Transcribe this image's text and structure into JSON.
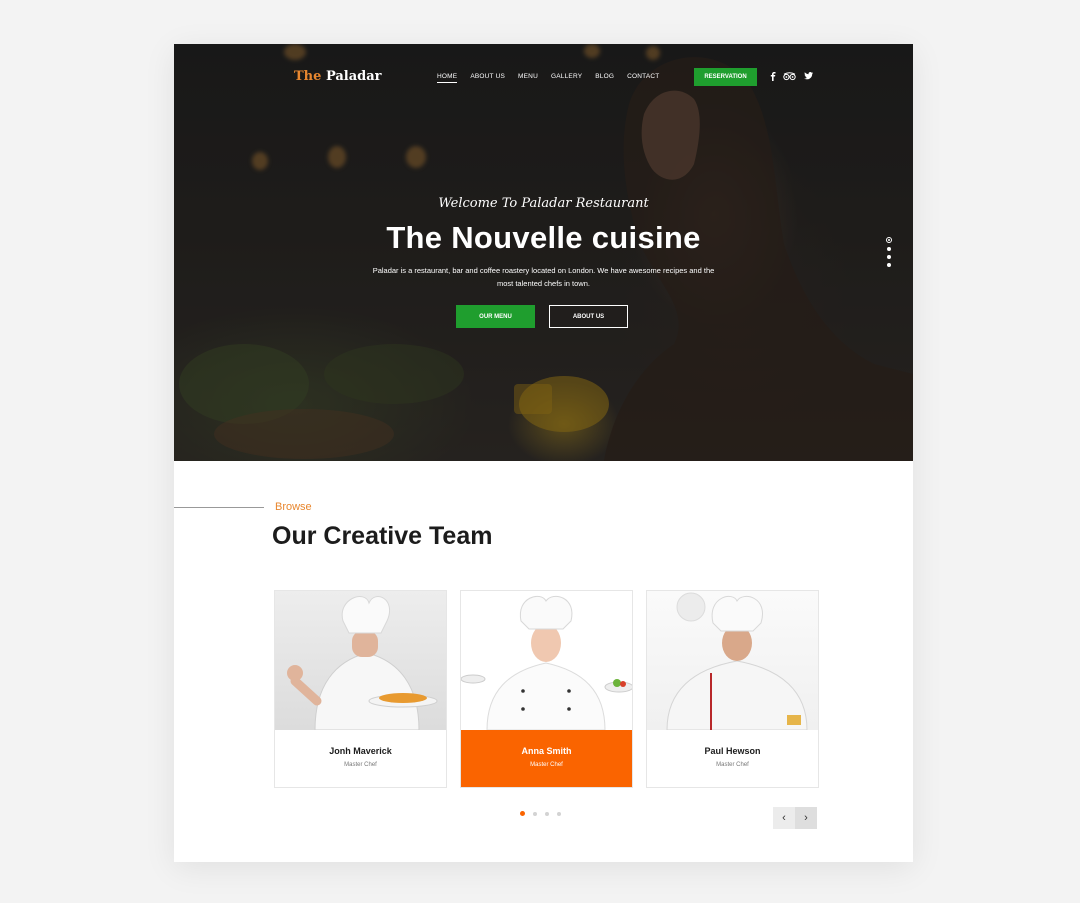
{
  "brand": {
    "logo_prefix": "The",
    "logo_name": "Paladar"
  },
  "nav": {
    "items": [
      {
        "label": "HOME",
        "active": true
      },
      {
        "label": "ABOUT US"
      },
      {
        "label": "MENU"
      },
      {
        "label": "GALLERY"
      },
      {
        "label": "BLOG"
      },
      {
        "label": "CONTACT"
      }
    ],
    "reservation_label": "RESERVATION",
    "social_icons": [
      "facebook-icon",
      "tripadvisor-icon",
      "twitter-icon"
    ]
  },
  "hero": {
    "welcome": "Welcome To Paladar Restaurant",
    "title": "The Nouvelle cuisine",
    "description": "Paladar is a restaurant, bar and coffee roastery located on London. We have awesome recipes and the most talented chefs in town.",
    "primary_button": "OUR MENU",
    "secondary_button": "ABOUT US",
    "slides": 4,
    "active_slide": 1
  },
  "team": {
    "eyebrow": "Browse",
    "title": "Our Creative Team",
    "members": [
      {
        "name": "Jonh Maverick",
        "role": "Master Chef"
      },
      {
        "name": "Anna Smith",
        "role": "Master Chef",
        "highlighted": true
      },
      {
        "name": "Paul Hewson",
        "role": "Master Chef"
      }
    ],
    "pager_pages": 4,
    "pager_active": 1,
    "prev_label": "‹",
    "next_label": "›"
  },
  "colors": {
    "accent_green": "#1f9e2e",
    "accent_orange": "#fa6400",
    "eyebrow_orange": "#e8872f"
  }
}
